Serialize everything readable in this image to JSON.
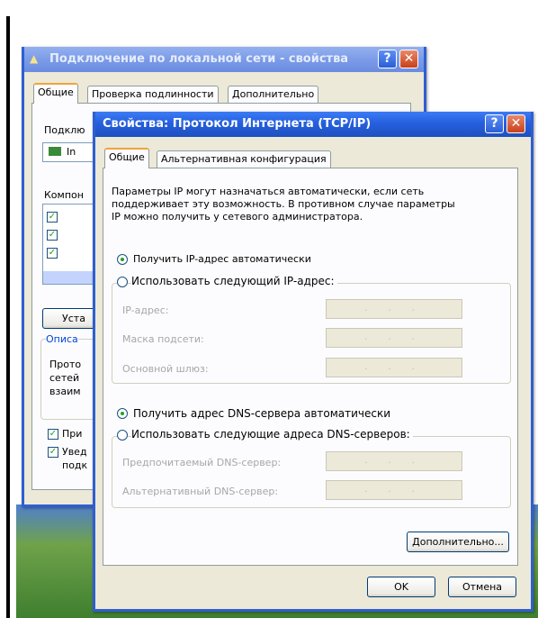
{
  "back_window": {
    "title": "Подключение по локальной сети - свойства",
    "tabs": [
      "Общие",
      "Проверка подлинности",
      "Дополнительно"
    ],
    "connect_label": "Подклю",
    "adapter_label": "In",
    "components_label": "Компон",
    "install_button": "Уста",
    "description_group": "Описа",
    "description_lines": [
      "Прото",
      "сетей",
      "взаим"
    ],
    "check_show_icon": "При",
    "check_notify_line1": "Увед",
    "check_notify_line2": "подк"
  },
  "front_window": {
    "title": "Свойства: Протокол Интернета (TCP/IP)",
    "tabs": [
      "Общие",
      "Альтернативная конфигурация"
    ],
    "info_lines": [
      "Параметры IP могут назначаться автоматически, если сеть",
      "поддерживает эту возможность. В противном случае параметры",
      "IP можно получить у сетевого администратора."
    ],
    "radio_ip_auto": "Получить IP-адрес автоматически",
    "radio_ip_manual": "Использовать следующий IP-адрес:",
    "ip_fields": {
      "ip_address": "IP-адрес:",
      "subnet_mask": "Маска подсети:",
      "gateway": "Основной шлюз:"
    },
    "ip_dots": ". . .",
    "radio_dns_auto": "Получить адрес DNS-сервера автоматически",
    "radio_dns_manual": "Использовать следующие адреса DNS-серверов:",
    "dns_fields": {
      "preferred": "Предпочитаемый DNS-сервер:",
      "alternate": "Альтернативный DNS-сервер:"
    },
    "advanced_button": "Дополнительно...",
    "ok_button": "OK",
    "cancel_button": "Отмена"
  },
  "colors": {
    "title_active": "#2660df",
    "title_inactive": "#7c9ce8",
    "dialog_bg": "#ece9d8",
    "tab_accent": "#f2a33a",
    "radio_dot": "#21a121"
  }
}
